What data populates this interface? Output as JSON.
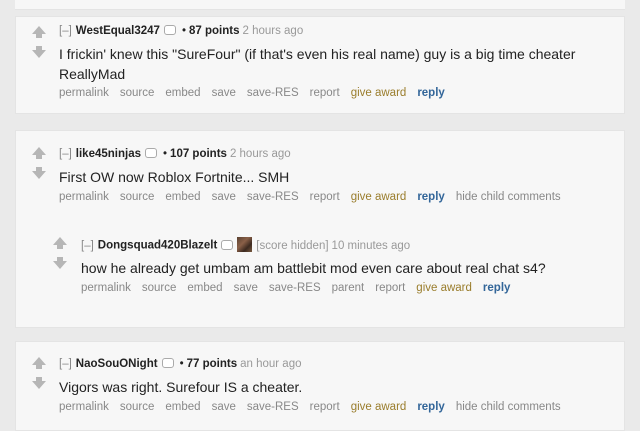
{
  "common": {
    "collapse": "[–]",
    "dot": "•",
    "buttons": {
      "permalink": "permalink",
      "source": "source",
      "embed": "embed",
      "save": "save",
      "save_res": "save-RES",
      "parent": "parent",
      "report": "report",
      "give_award": "give award",
      "reply": "reply",
      "hide_child": "hide child comments"
    }
  },
  "comments": [
    {
      "author": "WestEqual3247",
      "score": "87 points",
      "time": "2 hours ago",
      "body_line1": "I frickin' knew this \"SureFour\" (if that's even his real name) guy is a big time cheater",
      "body_line2": "ReallyMad"
    },
    {
      "author": "like45ninjas",
      "score": "107 points",
      "time": "2 hours ago",
      "body": "First OW now Roblox Fortnite... SMH"
    },
    {
      "author": "Dongsquad420Blazelt",
      "score_hidden": "[score hidden]",
      "time": "10 minutes ago",
      "body": "how he already get umbam am battlebit mod even care about real chat s4?"
    },
    {
      "author": "NaoSouONight",
      "score": "77 points",
      "time": "an hour ago",
      "body": "Vigors was right. Surefour IS a cheater."
    }
  ],
  "colors": {
    "background": "#eaeaea",
    "card": "#f7f7f7",
    "reply": "#336699",
    "give_award": "#9a7d2c",
    "muted": "#888888"
  }
}
